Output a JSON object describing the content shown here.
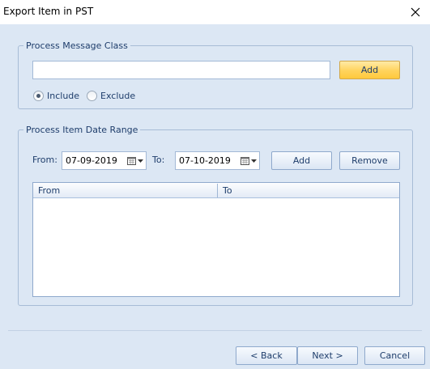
{
  "window": {
    "title": "Export Item in PST"
  },
  "message_class": {
    "legend": "Process Message Class",
    "input_value": "",
    "add_label": "Add",
    "include_label": "Include",
    "exclude_label": "Exclude",
    "selected": "include"
  },
  "date_range": {
    "legend": "Process Item Date Range",
    "from_label": "From:",
    "from_value": "07-09-2019",
    "to_label": "To:",
    "to_value": "07-10-2019",
    "add_label": "Add",
    "remove_label": "Remove",
    "columns": [
      "From",
      "To"
    ],
    "rows": []
  },
  "footer": {
    "back_label": "< Back",
    "next_label": "Next >",
    "cancel_label": "Cancel"
  },
  "icons": {
    "close": "close-icon",
    "calendar": "calendar-icon",
    "dropdown": "chevron-down-icon"
  }
}
